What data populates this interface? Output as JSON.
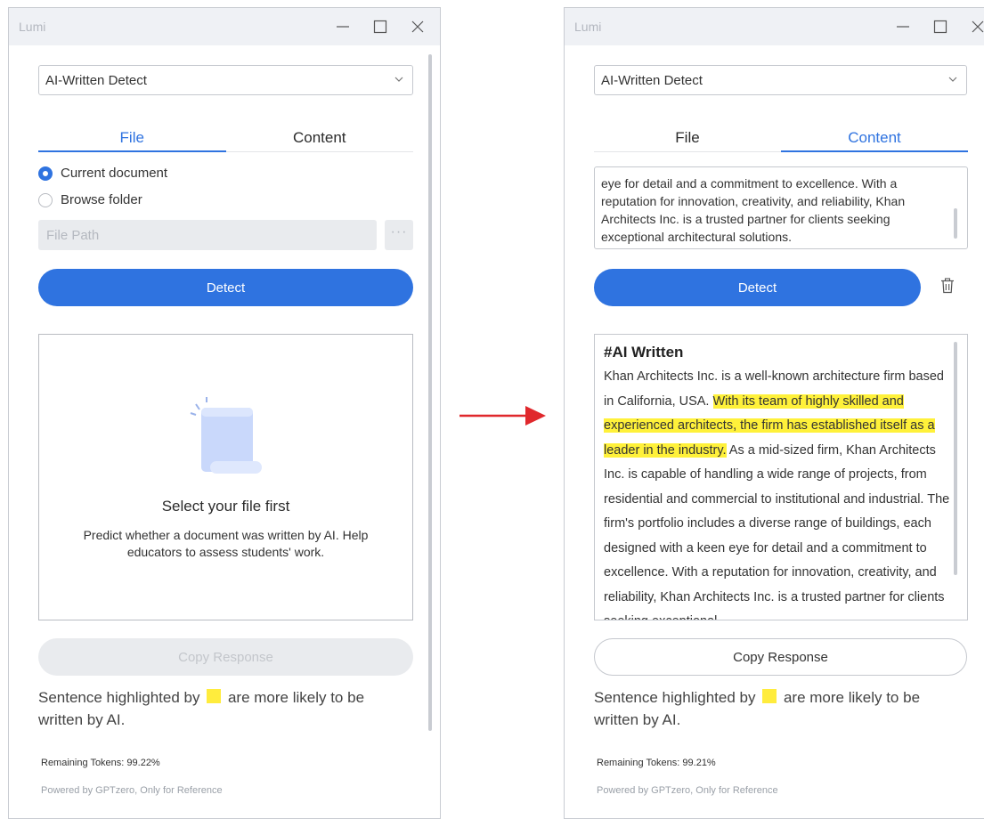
{
  "left_window": {
    "title": "Lumi",
    "mode_select": "AI-Written Detect",
    "tabs": [
      "File",
      "Content"
    ],
    "active_tab": "File",
    "radio_current": "Current document",
    "radio_browse": "Browse folder",
    "file_path_placeholder": "File Path",
    "browse_button": "···",
    "detect_label": "Detect",
    "empty_title": "Select your file first",
    "empty_desc": "Predict whether a document was written by AI. Help educators to assess students' work.",
    "copy_label": "Copy Response",
    "legend_before": "Sentence highlighted by",
    "legend_after": "are more likely to be written by AI.",
    "remaining_tokens": "Remaining Tokens: 99.22%",
    "powered_by": "Powered by GPTzero, Only for Reference"
  },
  "right_window": {
    "title": "Lumi",
    "mode_select": "AI-Written Detect",
    "tabs": [
      "File",
      "Content"
    ],
    "active_tab": "Content",
    "input_text": "eye for detail and a commitment to excellence. With a reputation for innovation, creativity, and reliability, Khan Architects Inc. is a trusted partner for clients seeking exceptional architectural solutions.",
    "detect_label": "Detect",
    "result_heading": "#AI Written",
    "result_part1": "Khan Architects Inc. is a well-known architecture firm based in California, USA.",
    "result_highlight": "With its team of highly skilled and experienced architects, the firm has established itself as a leader in the industry.",
    "result_part2": "As a mid-sized firm, Khan Architects Inc. is capable of handling a wide range of projects, from residential and commercial to institutional and industrial. The firm's portfolio includes a diverse range of buildings, each designed with a keen eye for detail and a commitment to excellence. With a reputation for innovation, creativity, and reliability, Khan Architects Inc. is a trusted partner for clients seeking exceptional",
    "copy_label": "Copy Response",
    "legend_before": "Sentence highlighted by",
    "legend_after": "are more likely to be written by AI.",
    "remaining_tokens": "Remaining Tokens: 99.21%",
    "powered_by": "Powered by GPTzero, Only for Reference"
  },
  "icons": {
    "minimize": "minimize-icon",
    "maximize": "maximize-icon",
    "close": "close-icon",
    "chevron": "chevron-down-icon",
    "document": "document-scroll-icon",
    "trash": "trash-icon",
    "arrow": "arrow-right-icon"
  },
  "colors": {
    "accent": "#2f73e0",
    "highlight": "#fff13a",
    "arrow": "#e0282c"
  }
}
